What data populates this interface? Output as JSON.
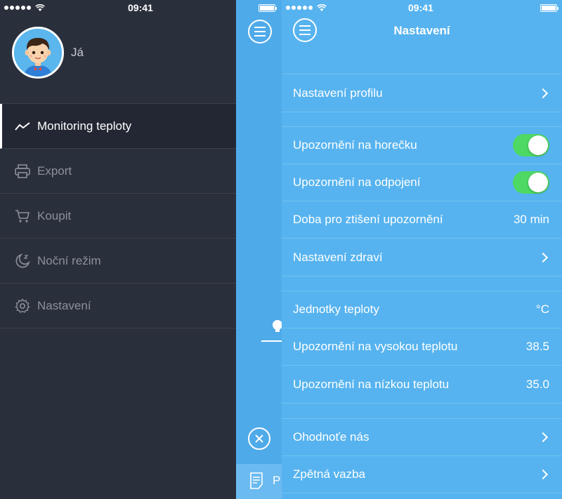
{
  "status_bar": {
    "time": "09:41"
  },
  "drawer": {
    "profile_name": "Já",
    "items": [
      {
        "label": "Monitoring teploty",
        "icon": "chart-line-icon",
        "active": true
      },
      {
        "label": "Export",
        "icon": "printer-icon",
        "active": false
      },
      {
        "label": "Koupit",
        "icon": "cart-icon",
        "active": false
      },
      {
        "label": "Noční režim",
        "icon": "moon-icon",
        "active": false
      },
      {
        "label": "Nastavení",
        "icon": "gear-icon",
        "active": false
      }
    ]
  },
  "strip": {
    "bottom_label": "P"
  },
  "settings": {
    "title": "Nastavení",
    "profile_settings": "Nastavení profilu",
    "fever_alert": "Upozornění na horečku",
    "fever_alert_on": true,
    "disconnect_alert": "Upozornění na odpojení",
    "disconnect_alert_on": true,
    "mute_duration_label": "Doba pro ztišení upozornění",
    "mute_duration_value": "30 min",
    "health_settings": "Nastavení zdraví",
    "temp_units_label": "Jednotky teploty",
    "temp_units_value": "°C",
    "high_temp_label": "Upozornění na vysokou teplotu",
    "high_temp_value": "38.5",
    "low_temp_label": "Upozornění na nízkou teplotu",
    "low_temp_value": "35.0",
    "rate_us": "Ohodnoťe nás",
    "feedback": "Zpětná vazba"
  },
  "colors": {
    "drawer_bg": "#2a2f3c",
    "settings_bg": "#56b3ef",
    "toggle_on": "#4dd964"
  }
}
